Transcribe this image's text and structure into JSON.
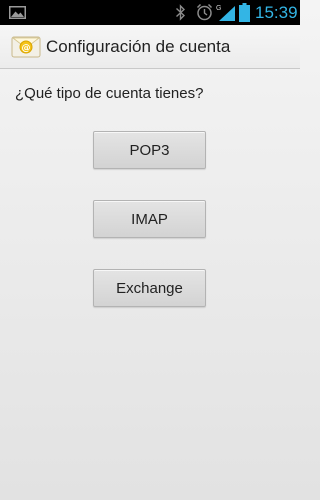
{
  "status_bar": {
    "time": "15:39",
    "network_type": "G",
    "icons": [
      "gallery-icon",
      "bluetooth-icon",
      "alarm-icon",
      "signal-icon",
      "battery-icon"
    ],
    "accent_color": "#33b5e5"
  },
  "action_bar": {
    "title": "Configuración de cuenta",
    "icon": "email-icon"
  },
  "question": "¿Qué tipo de cuenta tienes?",
  "account_types": {
    "pop3": "POP3",
    "imap": "IMAP",
    "exchange": "Exchange"
  }
}
